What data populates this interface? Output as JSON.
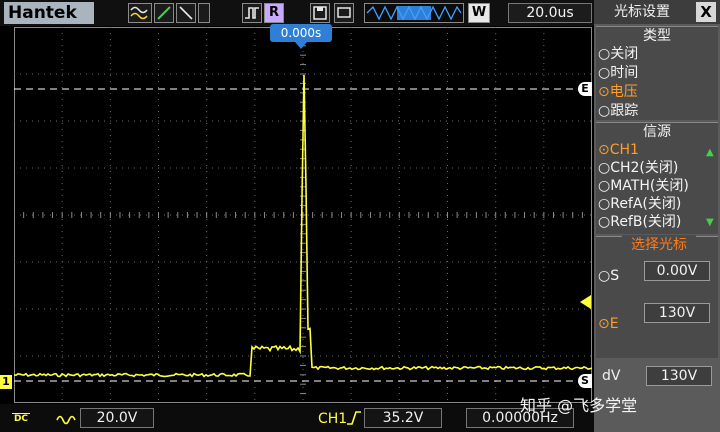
{
  "header": {
    "brand": "Hantek",
    "run_state": "R",
    "timebase": "20.0us",
    "acq_mode": "W"
  },
  "screen": {
    "trigger_position": "0.000s",
    "cursor_marker_top": "E",
    "cursor_marker_bottom": "S",
    "channel_marker": "1"
  },
  "footer": {
    "coupling": "DC",
    "ch1_scale": "20.0V",
    "trigger_source": "CH1",
    "trigger_level": "35.2V",
    "frequency": "0.00000Hz"
  },
  "menu": {
    "title": "光标设置",
    "close_label": "X",
    "type_group": {
      "header": "类型",
      "options": [
        "关闭",
        "时间",
        "电压",
        "跟踪"
      ],
      "selected": 2
    },
    "source_group": {
      "header": "信源",
      "options": [
        "CH1",
        "CH2(关闭)",
        "MATH(关闭)",
        "RefA(关闭)",
        "RefB(关闭)"
      ],
      "selected": 0
    },
    "select_group": {
      "header": "选择光标",
      "s_label": "S",
      "s_value": "0.00V",
      "e_label": "E",
      "e_value": "130V",
      "selected": "E"
    },
    "dv_label": "dV",
    "dv_value": "130V"
  },
  "watermark": "知乎 @飞多学堂",
  "colors": {
    "trace": "#ffff3c",
    "menu_selected": "#ff9d2a",
    "accent_blue": "#2f7fd6",
    "select_header": "#ff7a1a"
  }
}
